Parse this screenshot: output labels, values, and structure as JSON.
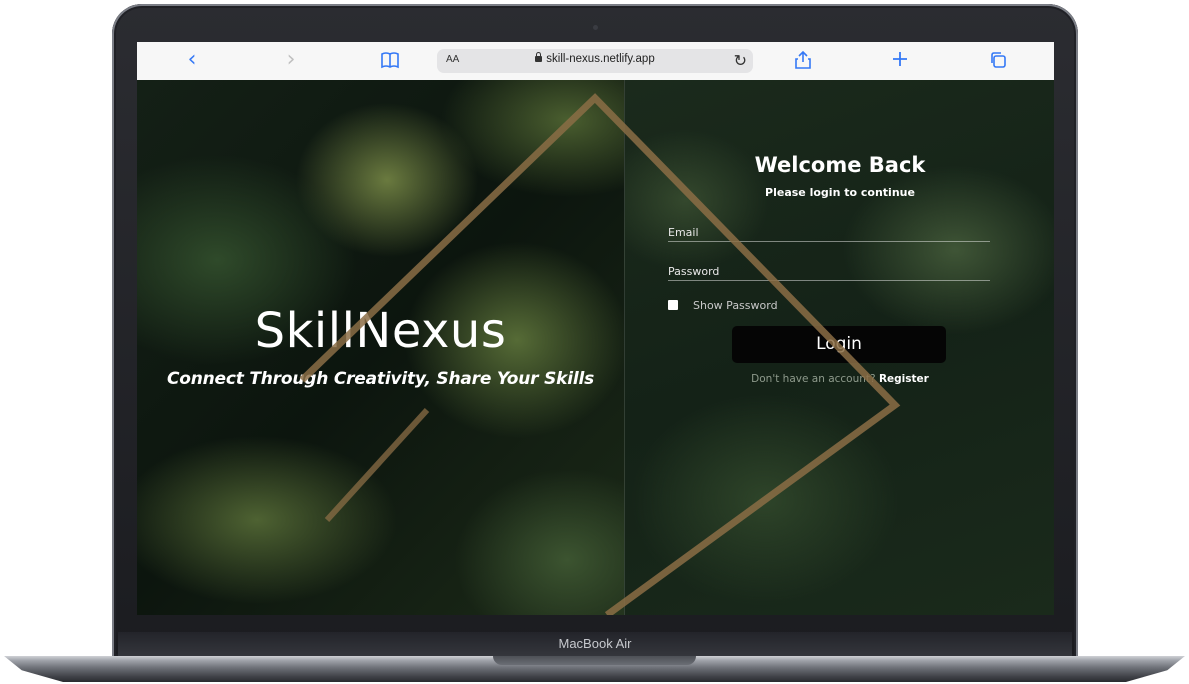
{
  "device": {
    "model_label": "MacBook Air"
  },
  "browser": {
    "back_icon": "chevron-left",
    "forward_icon": "chevron-right",
    "bookmarks_icon": "book",
    "text_size": "AA",
    "url": "skill-nexus.netlify.app",
    "reload_icon": "reload",
    "share_icon": "share",
    "new_tab_icon": "plus",
    "tabs_icon": "tabs"
  },
  "hero": {
    "brand": "SkillNexus",
    "tagline": "Connect Through Creativity, Share Your Skills"
  },
  "login": {
    "title": "Welcome Back",
    "subtitle": "Please login to continue",
    "email_placeholder": "Email",
    "email_value": "",
    "password_placeholder": "Password",
    "password_value": "",
    "show_password_label": "Show Password",
    "show_password_checked": false,
    "submit_label": "Login",
    "register_prompt": "Don't have an account?",
    "register_link": "Register"
  },
  "colors": {
    "accent_blue": "#3478f6",
    "frame_gold": "#8b6d45",
    "leaf_green": "#3c5430",
    "button_black": "#050505"
  }
}
